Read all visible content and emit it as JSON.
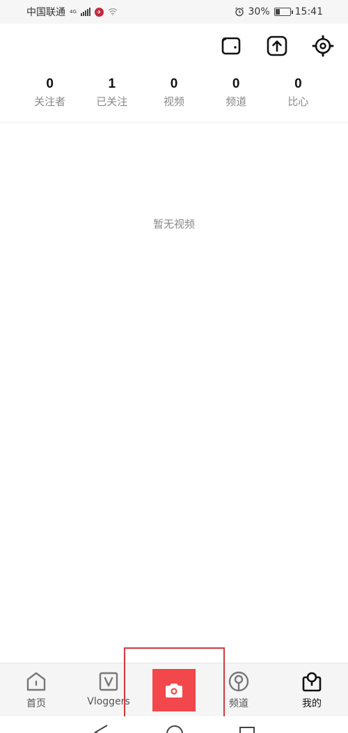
{
  "status_bar": {
    "carrier": "中国联通",
    "network_type": "4G",
    "battery_percent": "30%",
    "battery_level": 0.3,
    "time": "15:41"
  },
  "top_actions": [
    {
      "name": "wallet-icon"
    },
    {
      "name": "upload-icon"
    },
    {
      "name": "settings-gear-icon"
    }
  ],
  "stats": [
    {
      "value": "0",
      "label": "关注者"
    },
    {
      "value": "1",
      "label": "已关注"
    },
    {
      "value": "0",
      "label": "视频"
    },
    {
      "value": "0",
      "label": "频道"
    },
    {
      "value": "0",
      "label": "比心"
    }
  ],
  "empty_state": "暂无视频",
  "bottom_nav": {
    "home": "首页",
    "vloggers": "Vloggers",
    "channels": "频道",
    "me": "我的",
    "active": "me"
  },
  "colors": {
    "accent": "#f2474b",
    "highlight": "#d4373e"
  }
}
